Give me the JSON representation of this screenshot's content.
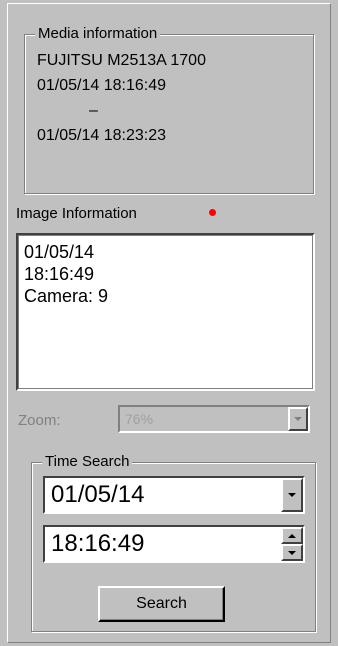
{
  "media_info": {
    "legend": "Media information",
    "lines": [
      "FUJITSU M2513A 1700",
      "01/05/14 18:16:49",
      "–",
      "01/05/14 18:23:23"
    ]
  },
  "image_info": {
    "label": "Image Information",
    "lines": [
      "01/05/14",
      "18:16:49",
      "Camera: 9"
    ]
  },
  "zoom": {
    "label": "Zoom:",
    "value": "76%"
  },
  "time_search": {
    "legend": "Time Search",
    "date_value": "01/05/14",
    "time_value": "18:16:49",
    "search_label": "Search"
  },
  "colors": {
    "indicator": "#ff0000",
    "face": "#c0c0c0"
  }
}
